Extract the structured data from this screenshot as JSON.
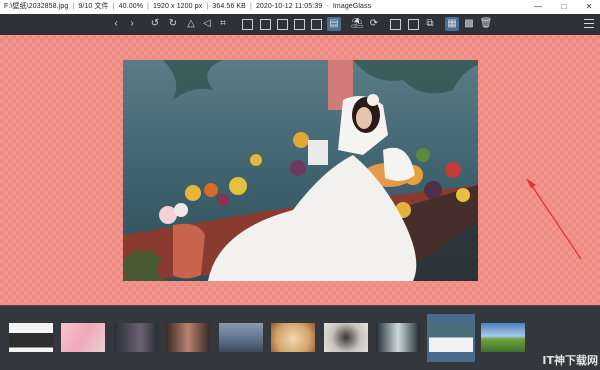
{
  "titlebar": {
    "path": "F:\\壁纸\\2032858.jpg",
    "index": "9/10 文件",
    "zoom": "40.00%",
    "dimensions": "1920 x 1200 px",
    "filesize": "364.56 KB",
    "datetime": "2020-10-12 11:05:39",
    "app": "ImageGlass",
    "minimize": "—",
    "maximize": "□",
    "close": "✕"
  },
  "toolbar": {
    "icons": [
      "prev-icon",
      "next-icon",
      "rotate-left-icon",
      "rotate-right-icon",
      "flip-vertical-icon",
      "flip-horizontal-icon",
      "crop-icon",
      "actual-size-icon",
      "auto-zoom-icon",
      "scale-to-width-icon",
      "scale-to-height-icon",
      "scale-to-fit-icon",
      "lock-zoom-icon",
      "refresh-icon",
      "adjust-window-icon",
      "color-picker-icon",
      "gallery-icon",
      "thumbnail-bar-icon",
      "checkerboard-icon",
      "delete-icon",
      "menu-icon"
    ]
  },
  "colors": {
    "checker_light": "#f1968e",
    "checker_dark": "#ee8a82",
    "arrow": "#e03030",
    "toolbar_bg": "#2f3136",
    "selected_thumb": "#4a6a8c"
  },
  "thumbnails": [
    {
      "name": "thumb-1",
      "colors": [
        "#f2f2f2",
        "#333333"
      ]
    },
    {
      "name": "thumb-2",
      "colors": [
        "#f5b7c4",
        "#e8d4d8"
      ]
    },
    {
      "name": "thumb-3",
      "colors": [
        "#2a2d3a",
        "#5c5a6e"
      ]
    },
    {
      "name": "thumb-4",
      "colors": [
        "#3a2a28",
        "#b8836f"
      ]
    },
    {
      "name": "thumb-5",
      "colors": [
        "#5d6f86",
        "#9aa9b8"
      ]
    },
    {
      "name": "thumb-6",
      "colors": [
        "#d4a56a",
        "#f0d7b4"
      ]
    },
    {
      "name": "thumb-7",
      "colors": [
        "#c7c4c0",
        "#3a3534"
      ]
    },
    {
      "name": "thumb-8",
      "colors": [
        "#1e2c33",
        "#cfd8de"
      ]
    },
    {
      "name": "thumb-9",
      "colors": [
        "#4a6f7a",
        "#f2f2f2"
      ]
    },
    {
      "name": "thumb-10",
      "colors": [
        "#4d7fc2",
        "#6fa542"
      ]
    }
  ],
  "watermark": "IT神下载网"
}
